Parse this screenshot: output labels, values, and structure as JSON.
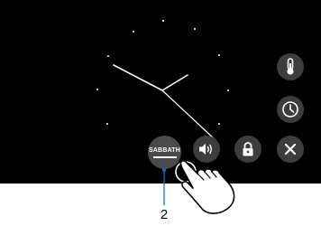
{
  "clock": {
    "icon": "analog-clock-face"
  },
  "side_buttons": [
    {
      "name": "thermometer",
      "icon": "thermometer-icon"
    },
    {
      "name": "clock",
      "icon": "clock-icon"
    }
  ],
  "bottom_buttons": {
    "sabbath_label": "SABBATH",
    "sound_icon": "speaker-icon",
    "lock_icon": "lock-icon",
    "close_icon": "close-icon"
  },
  "callout": {
    "number": "2"
  },
  "colors": {
    "screen": "#000000",
    "button": "#3d3d3d",
    "sabbath_button": "#4a4a4a",
    "foreground": "#ffffff"
  }
}
